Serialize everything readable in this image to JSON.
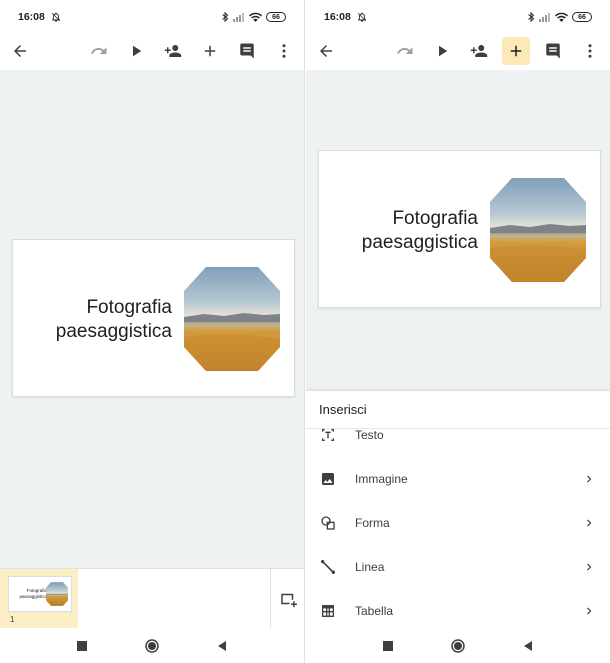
{
  "status_bar": {
    "time": "16:08",
    "battery": "66"
  },
  "presentation": {
    "slide_title": "Fotografia\npaesaggistica",
    "slide_number": "1"
  },
  "insert_menu": {
    "title": "Inserisci",
    "items": [
      {
        "label": "Testo",
        "icon": "text-box-icon",
        "has_submenu": false
      },
      {
        "label": "Immagine",
        "icon": "image-icon",
        "has_submenu": true
      },
      {
        "label": "Forma",
        "icon": "shapes-icon",
        "has_submenu": true
      },
      {
        "label": "Linea",
        "icon": "line-icon",
        "has_submenu": true
      },
      {
        "label": "Tabella",
        "icon": "table-icon",
        "has_submenu": true
      }
    ]
  },
  "colors": {
    "active_button": "#fde9b5",
    "canvas_background": "#eef2f2",
    "selected_thumbnail": "#fbeec5"
  }
}
